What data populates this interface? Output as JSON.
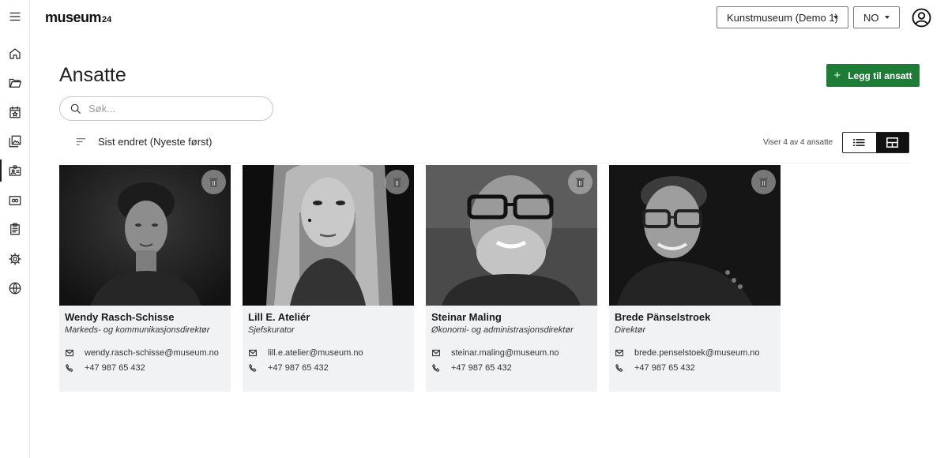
{
  "app": {
    "logo_main": "museum",
    "logo_sub": "24"
  },
  "header": {
    "museum_select": "Kunstmuseum (Demo 1)",
    "language_select": "NO"
  },
  "sidebar": {
    "items": [
      {
        "icon": "hamburger-menu-icon"
      },
      {
        "icon": "home-icon"
      },
      {
        "icon": "folder-open-icon"
      },
      {
        "icon": "calendar-star-icon"
      },
      {
        "icon": "image-gallery-icon"
      },
      {
        "icon": "contact-card-icon",
        "active": true
      },
      {
        "icon": "loan-card-icon"
      },
      {
        "icon": "clipboard-icon"
      },
      {
        "icon": "gear-icon"
      },
      {
        "icon": "globe-icon"
      }
    ]
  },
  "page": {
    "title": "Ansatte",
    "add_button": "Legg til ansatt",
    "search_placeholder": "Søk...",
    "sort_label": "Sist endret (Nyeste først)",
    "count_label": "Viser 4 av 4 ansatte",
    "active_view": "grid"
  },
  "employees": [
    {
      "name": "Wendy Rasch-Schisse",
      "role": "Markeds- og kommunikasjonsdirektør",
      "email": "wendy.rasch-schisse@museum.no",
      "phone": "+47 987 65 432"
    },
    {
      "name": "Lill E. Ateliér",
      "role": "Sjefskurator",
      "email": "lill.e.atelier@museum.no",
      "phone": "+47 987 65 432"
    },
    {
      "name": "Steinar Maling",
      "role": "Økonomi- og administrasjonsdirektør",
      "email": "steinar.maling@museum.no",
      "phone": "+47 987 65 432"
    },
    {
      "name": "Brede Pänselstroek",
      "role": "Direktør",
      "email": "brede.penselstoek@museum.no",
      "phone": "+47 987 65 432"
    }
  ],
  "colors": {
    "primary_button": "#1d7c36",
    "card_background": "#f1f2f3",
    "toggle_active": "#111111"
  }
}
